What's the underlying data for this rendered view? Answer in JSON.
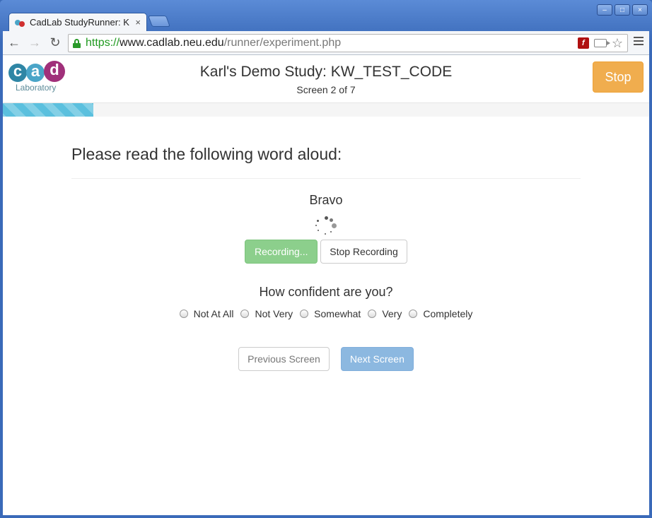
{
  "browser": {
    "tab_title": "CadLab StudyRunner: K",
    "tab_close": "×",
    "url_scheme": "https://",
    "url_host": "www.cadlab.neu.edu",
    "url_path": "/runner/experiment.php",
    "back_label": "←",
    "forward_label": "→",
    "reload_label": "↻",
    "star": "☆",
    "flash": "f",
    "window_minimize": "–",
    "window_maximize": "□",
    "window_close": "×"
  },
  "header": {
    "logo_letters": [
      "c",
      "a",
      "d"
    ],
    "logo_caption": "Laboratory",
    "study_title": "Karl's Demo Study: KW_TEST_CODE",
    "screen_count": "Screen 2 of 7",
    "stop_label": "Stop"
  },
  "progress": {
    "fraction": 0.14
  },
  "main": {
    "prompt": "Please read the following word aloud:",
    "word": "Bravo",
    "recording_label": "Recording...",
    "stop_recording_label": "Stop Recording",
    "confidence_question": "How confident are you?",
    "confidence_options": [
      "Not At All",
      "Not Very",
      "Somewhat",
      "Very",
      "Completely"
    ],
    "previous_label": "Previous Screen",
    "next_label": "Next Screen"
  },
  "colors": {
    "stop_button": "#f0ad4e",
    "progress_bar": "#5bc0de",
    "recording_button": "#8ccf8c",
    "next_button": "#8cb8e0",
    "logo_c": "#2f86a5",
    "logo_a": "#4aa5c8",
    "logo_d": "#a0307a"
  }
}
